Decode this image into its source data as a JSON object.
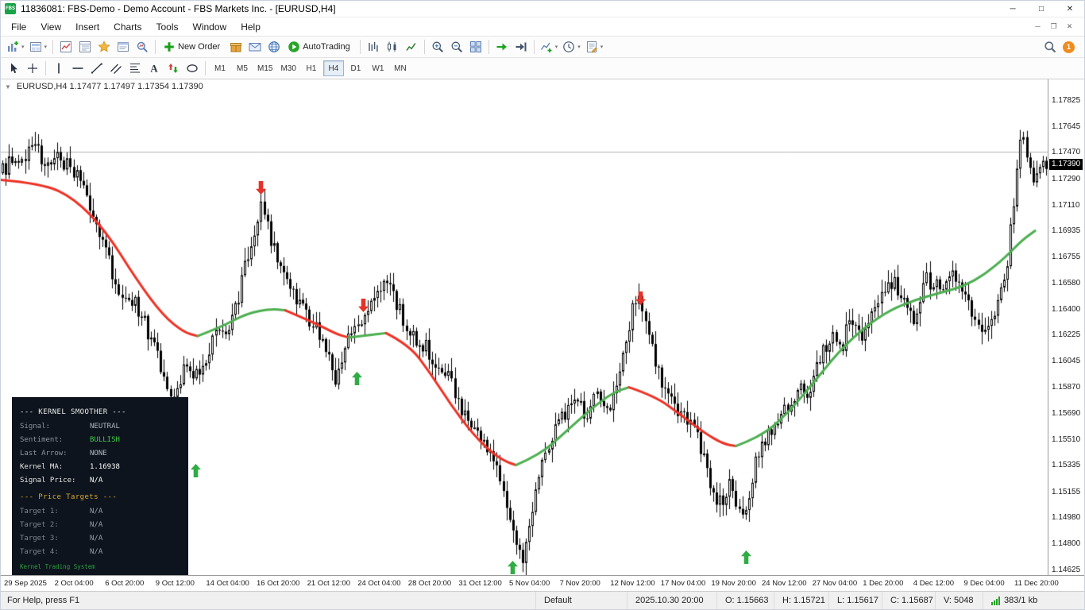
{
  "window": {
    "logo": "FBS",
    "title": "11836081: FBS-Demo - Demo Account - FBS Markets Inc. - [EURUSD,H4]",
    "controls": {
      "minimize": "─",
      "maximize": "□",
      "close": "✕"
    }
  },
  "menu": {
    "items": [
      "File",
      "View",
      "Insert",
      "Charts",
      "Tools",
      "Window",
      "Help"
    ],
    "mdi_controls": [
      "─",
      "❐",
      "✕"
    ]
  },
  "toolbar_main": {
    "groups": [
      [
        {
          "name": "new-chart",
          "glyph": "chartplus",
          "caret": true
        },
        {
          "name": "profiles",
          "glyph": "profiles",
          "caret": true
        }
      ],
      [
        {
          "name": "market-watch",
          "glyph": "market"
        },
        {
          "name": "data-window",
          "glyph": "datawin"
        },
        {
          "name": "navigator",
          "glyph": "star"
        },
        {
          "name": "terminal",
          "glyph": "terminal"
        },
        {
          "name": "strategy-tester",
          "glyph": "tester"
        }
      ],
      [
        {
          "name": "new-order",
          "glyph": "order",
          "label": "New Order"
        },
        {
          "name": "market-store",
          "glyph": "box"
        },
        {
          "name": "codebase",
          "glyph": "mail"
        },
        {
          "name": "mql5-community",
          "glyph": "globe"
        },
        {
          "name": "autotrading",
          "glyph": "play",
          "label": "AutoTrading"
        }
      ],
      [
        {
          "name": "bar-chart-mode",
          "glyph": "bars"
        },
        {
          "name": "candlestick-mode",
          "glyph": "candlesIcon"
        },
        {
          "name": "line-chart-mode",
          "glyph": "linechart"
        }
      ],
      [
        {
          "name": "zoom-in",
          "glyph": "zoomin"
        },
        {
          "name": "zoom-out",
          "glyph": "zoomout"
        },
        {
          "name": "tile-windows",
          "glyph": "tile"
        }
      ],
      [
        {
          "name": "auto-scroll",
          "glyph": "autoscroll"
        },
        {
          "name": "chart-shift",
          "glyph": "shift"
        }
      ],
      [
        {
          "name": "indicators",
          "glyph": "indicator",
          "caret": true
        },
        {
          "name": "periods",
          "glyph": "clock",
          "caret": true
        },
        {
          "name": "templates",
          "glyph": "template",
          "caret": true
        }
      ]
    ],
    "notification_count": "1"
  },
  "toolbar_tools": {
    "tools": [
      {
        "name": "cursor",
        "glyph": "cursor"
      },
      {
        "name": "crosshair",
        "glyph": "crosshair"
      },
      {
        "name": "vertical-line",
        "glyph": "vline"
      },
      {
        "name": "horizontal-line",
        "glyph": "hline"
      },
      {
        "name": "trendline",
        "glyph": "trend"
      },
      {
        "name": "equidistant-channel",
        "glyph": "channel"
      },
      {
        "name": "fibonacci-retracement",
        "glyph": "fibo"
      },
      {
        "name": "text-label",
        "glyph": "textA"
      },
      {
        "name": "arrow-objects",
        "glyph": "arrowsTool"
      },
      {
        "name": "shapes",
        "glyph": "shapes"
      }
    ],
    "timeframes": [
      "M1",
      "M5",
      "M15",
      "M30",
      "H1",
      "H4",
      "D1",
      "W1",
      "MN"
    ],
    "active_timeframe": "H4"
  },
  "chart": {
    "one_click_arrow": "▼",
    "symbol_header": "EURUSD,H4  1.17477 1.17497 1.17354 1.17390"
  },
  "chart_data": {
    "type": "candlestick",
    "symbol": "EURUSD",
    "timeframe": "H4",
    "ylim": [
      1.1459,
      1.1797
    ],
    "current_price": 1.1739,
    "current_price_label": "1.17390",
    "bid_line": 1.17477,
    "price_axis_labels": [
      1.17825,
      1.17645,
      1.1747,
      1.1729,
      1.1711,
      1.16935,
      1.16755,
      1.1658,
      1.164,
      1.16225,
      1.16045,
      1.1587,
      1.1569,
      1.1551,
      1.15335,
      1.15155,
      1.1498,
      1.148,
      1.14625
    ],
    "time_labels": [
      "29 Sep 2025",
      "2 Oct 04:00",
      "6 Oct 20:00",
      "9 Oct 12:00",
      "14 Oct 04:00",
      "16 Oct 20:00",
      "21 Oct 12:00",
      "24 Oct 04:00",
      "28 Oct 20:00",
      "31 Oct 12:00",
      "5 Nov 04:00",
      "7 Nov 20:00",
      "12 Nov 12:00",
      "17 Nov 04:00",
      "19 Nov 20:00",
      "24 Nov 12:00",
      "27 Nov 04:00",
      "1 Dec 20:00",
      "4 Dec 12:00",
      "9 Dec 04:00",
      "11 Dec 20:00"
    ],
    "price_path": [
      [
        0.0,
        1.1733
      ],
      [
        0.01,
        1.1741
      ],
      [
        0.02,
        1.1737
      ],
      [
        0.028,
        1.1757
      ],
      [
        0.036,
        1.1748
      ],
      [
        0.045,
        1.1737
      ],
      [
        0.055,
        1.1744
      ],
      [
        0.065,
        1.1738
      ],
      [
        0.075,
        1.173
      ],
      [
        0.085,
        1.1712
      ],
      [
        0.095,
        1.169
      ],
      [
        0.105,
        1.1668
      ],
      [
        0.115,
        1.1652
      ],
      [
        0.125,
        1.1645
      ],
      [
        0.135,
        1.1638
      ],
      [
        0.145,
        1.1615
      ],
      [
        0.155,
        1.1598
      ],
      [
        0.163,
        1.158
      ],
      [
        0.17,
        1.1594
      ],
      [
        0.18,
        1.1602
      ],
      [
        0.19,
        1.1592
      ],
      [
        0.2,
        1.1615
      ],
      [
        0.21,
        1.1626
      ],
      [
        0.22,
        1.1632
      ],
      [
        0.23,
        1.1658
      ],
      [
        0.24,
        1.169
      ],
      [
        0.248,
        1.1709
      ],
      [
        0.256,
        1.1692
      ],
      [
        0.264,
        1.1672
      ],
      [
        0.272,
        1.1656
      ],
      [
        0.282,
        1.1648
      ],
      [
        0.292,
        1.1636
      ],
      [
        0.302,
        1.1626
      ],
      [
        0.312,
        1.161
      ],
      [
        0.32,
        1.159
      ],
      [
        0.33,
        1.162
      ],
      [
        0.34,
        1.1626
      ],
      [
        0.35,
        1.1642
      ],
      [
        0.36,
        1.1653
      ],
      [
        0.37,
        1.1661
      ],
      [
        0.38,
        1.1642
      ],
      [
        0.39,
        1.1624
      ],
      [
        0.4,
        1.1619
      ],
      [
        0.41,
        1.1611
      ],
      [
        0.42,
        1.16
      ],
      [
        0.43,
        1.1591
      ],
      [
        0.44,
        1.157
      ],
      [
        0.45,
        1.1557
      ],
      [
        0.46,
        1.1549
      ],
      [
        0.47,
        1.1541
      ],
      [
        0.478,
        1.1518
      ],
      [
        0.486,
        1.1499
      ],
      [
        0.492,
        1.1481
      ],
      [
        0.497,
        1.1469
      ],
      [
        0.503,
        1.1483
      ],
      [
        0.51,
        1.1511
      ],
      [
        0.52,
        1.1546
      ],
      [
        0.53,
        1.1559
      ],
      [
        0.54,
        1.1571
      ],
      [
        0.55,
        1.1576
      ],
      [
        0.56,
        1.1569
      ],
      [
        0.57,
        1.1581
      ],
      [
        0.58,
        1.1573
      ],
      [
        0.59,
        1.1593
      ],
      [
        0.6,
        1.1626
      ],
      [
        0.606,
        1.1649
      ],
      [
        0.612,
        1.1641
      ],
      [
        0.622,
        1.1613
      ],
      [
        0.632,
        1.1589
      ],
      [
        0.642,
        1.1573
      ],
      [
        0.652,
        1.1571
      ],
      [
        0.662,
        1.1559
      ],
      [
        0.672,
        1.1537
      ],
      [
        0.682,
        1.1513
      ],
      [
        0.69,
        1.1506
      ],
      [
        0.696,
        1.1521
      ],
      [
        0.702,
        1.1501
      ],
      [
        0.708,
        1.1496
      ],
      [
        0.714,
        1.1513
      ],
      [
        0.722,
        1.1541
      ],
      [
        0.732,
        1.1553
      ],
      [
        0.742,
        1.1563
      ],
      [
        0.752,
        1.1573
      ],
      [
        0.762,
        1.1589
      ],
      [
        0.772,
        1.1581
      ],
      [
        0.782,
        1.1605
      ],
      [
        0.792,
        1.1623
      ],
      [
        0.802,
        1.1613
      ],
      [
        0.812,
        1.1635
      ],
      [
        0.822,
        1.1619
      ],
      [
        0.832,
        1.1641
      ],
      [
        0.842,
        1.1655
      ],
      [
        0.852,
        1.1661
      ],
      [
        0.862,
        1.1646
      ],
      [
        0.872,
        1.1634
      ],
      [
        0.882,
        1.1662
      ],
      [
        0.892,
        1.1655
      ],
      [
        0.902,
        1.1656
      ],
      [
        0.912,
        1.1663
      ],
      [
        0.922,
        1.1649
      ],
      [
        0.932,
        1.1631
      ],
      [
        0.942,
        1.1623
      ],
      [
        0.952,
        1.1641
      ],
      [
        0.96,
        1.1667
      ],
      [
        0.966,
        1.1702
      ],
      [
        0.971,
        1.1737
      ],
      [
        0.976,
        1.1761
      ],
      [
        0.981,
        1.1741
      ],
      [
        0.986,
        1.1723
      ],
      [
        0.991,
        1.1737
      ],
      [
        1.0,
        1.1739
      ]
    ],
    "smoother_segments": [
      {
        "trend": "down",
        "points": [
          [
            0.0,
            1.17285
          ],
          [
            0.04,
            1.1726
          ],
          [
            0.07,
            1.1716
          ],
          [
            0.1,
            1.1694
          ],
          [
            0.13,
            1.166
          ],
          [
            0.155,
            1.1636
          ],
          [
            0.175,
            1.16245
          ],
          [
            0.188,
            1.1622
          ]
        ]
      },
      {
        "trend": "up",
        "points": [
          [
            0.188,
            1.1622
          ],
          [
            0.21,
            1.1628
          ],
          [
            0.235,
            1.16375
          ],
          [
            0.258,
            1.16405
          ],
          [
            0.272,
            1.16395
          ]
        ]
      },
      {
        "trend": "down",
        "points": [
          [
            0.272,
            1.16395
          ],
          [
            0.3,
            1.1631
          ],
          [
            0.32,
            1.16235
          ],
          [
            0.332,
            1.1621
          ]
        ]
      },
      {
        "trend": "up",
        "points": [
          [
            0.332,
            1.1621
          ],
          [
            0.35,
            1.16225
          ],
          [
            0.368,
            1.1624
          ]
        ]
      },
      {
        "trend": "down",
        "points": [
          [
            0.368,
            1.1624
          ],
          [
            0.39,
            1.1616
          ],
          [
            0.41,
            1.1597
          ],
          [
            0.43,
            1.1575
          ],
          [
            0.45,
            1.1556
          ],
          [
            0.468,
            1.1543
          ],
          [
            0.482,
            1.15365
          ],
          [
            0.492,
            1.1534
          ]
        ]
      },
      {
        "trend": "up",
        "points": [
          [
            0.492,
            1.1534
          ],
          [
            0.515,
            1.1541
          ],
          [
            0.54,
            1.1557
          ],
          [
            0.565,
            1.1573
          ],
          [
            0.585,
            1.15835
          ],
          [
            0.6,
            1.1587
          ]
        ]
      },
      {
        "trend": "down",
        "points": [
          [
            0.6,
            1.1587
          ],
          [
            0.625,
            1.1581
          ],
          [
            0.65,
            1.1568
          ],
          [
            0.672,
            1.1556
          ],
          [
            0.69,
            1.15485
          ],
          [
            0.702,
            1.1547
          ]
        ]
      },
      {
        "trend": "up",
        "points": [
          [
            0.702,
            1.1547
          ],
          [
            0.725,
            1.1553
          ],
          [
            0.75,
            1.1568
          ],
          [
            0.775,
            1.1589
          ],
          [
            0.8,
            1.1611
          ],
          [
            0.825,
            1.1628
          ],
          [
            0.85,
            1.164
          ],
          [
            0.875,
            1.1647
          ],
          [
            0.9,
            1.1652
          ],
          [
            0.92,
            1.1656
          ],
          [
            0.94,
            1.1664
          ],
          [
            0.96,
            1.1676
          ],
          [
            0.975,
            1.1687
          ],
          [
            0.988,
            1.16938
          ]
        ]
      }
    ],
    "arrows": [
      {
        "dir": "down",
        "x": 0.2485,
        "price": 1.1723
      },
      {
        "dir": "down",
        "x": 0.346,
        "price": 1.1643
      },
      {
        "dir": "up",
        "x": 0.34,
        "price": 1.1593
      },
      {
        "dir": "up",
        "x": 0.186,
        "price": 1.153
      },
      {
        "dir": "up",
        "x": 0.489,
        "price": 1.1464
      },
      {
        "dir": "down",
        "x": 0.611,
        "price": 1.1648
      },
      {
        "dir": "up",
        "x": 0.712,
        "price": 1.1471
      }
    ],
    "colors": {
      "up_segment": "#4caf50",
      "down_segment": "#ef3124",
      "bull": "#ffffff",
      "bear": "#000000",
      "wick": "#000000",
      "bid_line": "#b5b5b5",
      "arrow_up": "#30ac45",
      "arrow_down": "#e63228"
    }
  },
  "info_panel": {
    "rows": [
      {
        "header": "--- KERNEL SMOOTHER ---",
        "color": "#ececec"
      },
      {
        "label": "Signal:",
        "value": "NEUTRAL",
        "label_color": "#8d949c",
        "value_color": "#b0b7bf"
      },
      {
        "label": "Sentiment:",
        "value": "BULLISH",
        "label_color": "#8d949c",
        "value_color": "#3ecb4a"
      },
      {
        "label": "Last Arrow:",
        "value": "NONE",
        "label_color": "#8d949c",
        "value_color": "#b0b7bf"
      },
      {
        "label": "Kernel MA:",
        "value": "1.16938",
        "label_color": "#e6e6e6",
        "value_color": "#ffffff"
      },
      {
        "label": "Signal Price:",
        "value": "N/A",
        "label_color": "#e6e6e6",
        "value_color": "#ffffff"
      },
      {
        "header": "--- Price Targets ---",
        "color": "#d9a62e",
        "gap": true
      },
      {
        "label": "Target 1:",
        "value": "N/A",
        "label_color": "#7d848c",
        "value_color": "#99a0a8"
      },
      {
        "label": "Target 2:",
        "value": "N/A",
        "label_color": "#7d848c",
        "value_color": "#99a0a8"
      },
      {
        "label": "Target 3:",
        "value": "N/A",
        "label_color": "#7d848c",
        "value_color": "#99a0a8"
      },
      {
        "label": "Target 4:",
        "value": "N/A",
        "label_color": "#7d848c",
        "value_color": "#99a0a8"
      },
      {
        "footer": "Kernel Trading System",
        "color": "#2f9e44"
      }
    ]
  },
  "status_bar": {
    "help": "For Help, press F1",
    "profile": "Default",
    "bar_time": "2025.10.30 20:00",
    "ohlcv": {
      "o": "O: 1.15663",
      "h": "H: 1.15721",
      "l": "L: 1.15617",
      "c": "C: 1.15687",
      "v": "V: 5048"
    },
    "traffic": "383/1 kb"
  }
}
